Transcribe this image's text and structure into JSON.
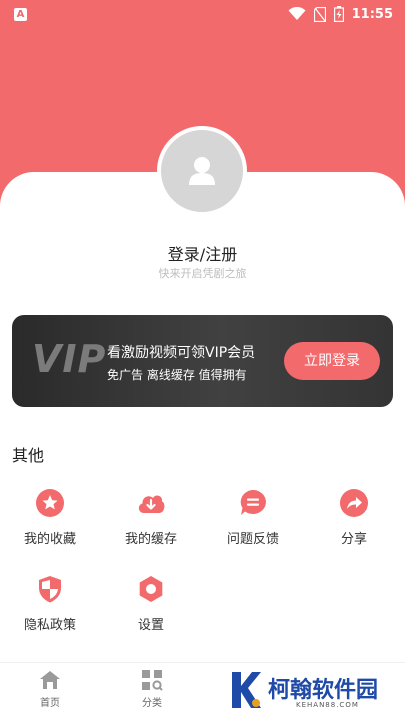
{
  "status_bar": {
    "app_indicator": "A",
    "time": "11:55",
    "icons": [
      "wifi-icon",
      "no-sim-icon",
      "battery-charging-icon"
    ]
  },
  "profile": {
    "avatar_icon": "user-icon",
    "login_title": "登录/注册",
    "login_subtitle": "快来开启凭剧之旅"
  },
  "vip_banner": {
    "logo": "VIP",
    "headline": "看激励视频可领VIP会员",
    "benefits": "免广告 离线缓存 值得拥有",
    "button_label": "立即登录"
  },
  "other_section": {
    "title": "其他",
    "items": [
      {
        "label": "我的收藏",
        "icon": "star-icon"
      },
      {
        "label": "我的缓存",
        "icon": "cloud-download-icon"
      },
      {
        "label": "问题反馈",
        "icon": "feedback-icon"
      },
      {
        "label": "分享",
        "icon": "share-icon"
      },
      {
        "label": "隐私政策",
        "icon": "shield-icon"
      },
      {
        "label": "设置",
        "icon": "settings-icon"
      }
    ]
  },
  "tab_bar": {
    "tabs": [
      {
        "label": "首页",
        "icon": "home-icon"
      },
      {
        "label": "分类",
        "icon": "category-icon"
      }
    ]
  },
  "watermark": {
    "text": "柯翰软件园",
    "subtext": "KEHAN88.COM"
  },
  "colors": {
    "accent": "#f26a6c",
    "vip_background": "#333333"
  }
}
